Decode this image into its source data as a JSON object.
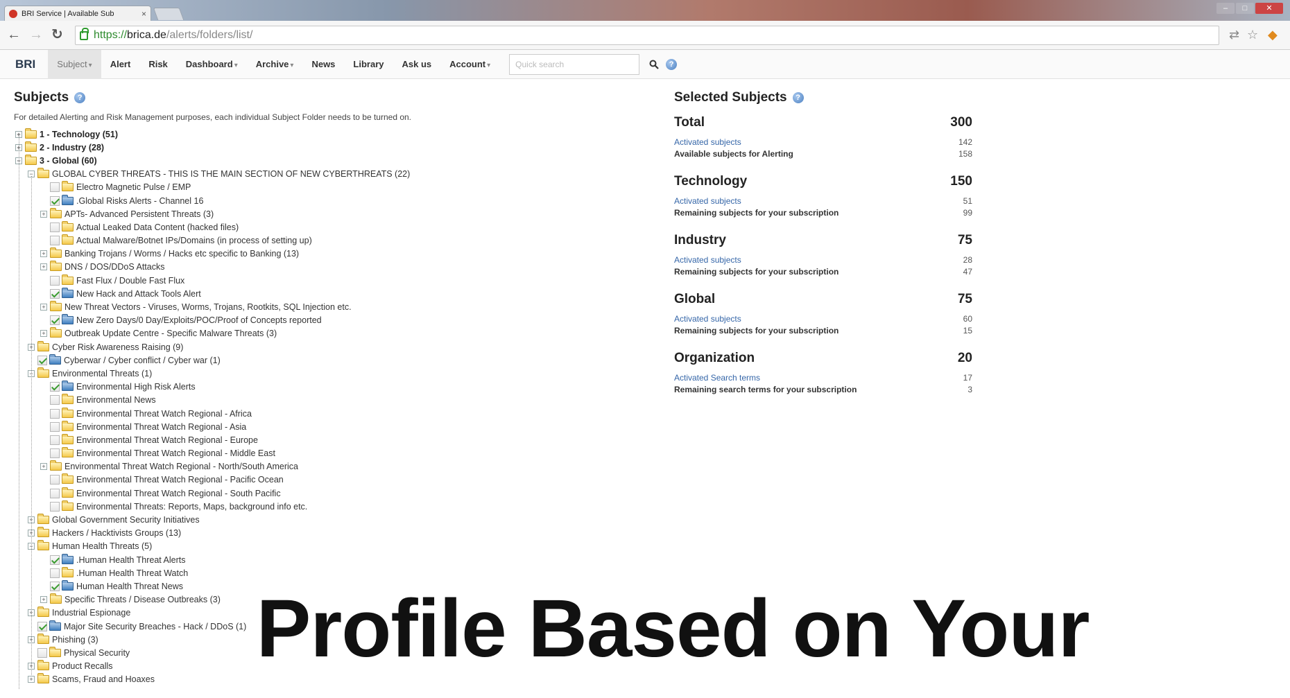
{
  "browser": {
    "tab_title": "BRI Service | Available Sub",
    "tab_close": "×",
    "url_scheme": "https://",
    "url_host": "brica.de",
    "url_path": "/alerts/folders/list/"
  },
  "navbar": {
    "brand": "BRI",
    "items": [
      {
        "label": "Subject",
        "dropdown": true,
        "active": true
      },
      {
        "label": "Alert",
        "dropdown": false
      },
      {
        "label": "Risk",
        "dropdown": false
      },
      {
        "label": "Dashboard",
        "dropdown": true
      },
      {
        "label": "Archive",
        "dropdown": true
      },
      {
        "label": "News",
        "dropdown": false
      },
      {
        "label": "Library",
        "dropdown": false
      },
      {
        "label": "Ask us",
        "dropdown": false
      },
      {
        "label": "Account",
        "dropdown": true
      }
    ],
    "search_placeholder": "Quick search"
  },
  "subjects": {
    "title": "Subjects",
    "description": "For detailed Alerting and Risk Management purposes, each individual Subject Folder needs to be turned on.",
    "tree": [
      {
        "label": "1 - Technology (51)",
        "level": 0,
        "expander": "+",
        "checkbox": false,
        "bold": true,
        "folder": "yellow"
      },
      {
        "label": "2 - Industry (28)",
        "level": 0,
        "expander": "+",
        "checkbox": false,
        "bold": true,
        "folder": "yellow"
      },
      {
        "label": "3 - Global (60)",
        "level": 0,
        "expander": "-",
        "checkbox": false,
        "bold": true,
        "folder": "yellow"
      },
      {
        "label": "GLOBAL CYBER THREATS - THIS IS THE MAIN SECTION OF NEW CYBERTHREATS (22)",
        "level": 1,
        "expander": "-",
        "checkbox": false,
        "folder": "yellow"
      },
      {
        "label": "Electro Magnetic Pulse / EMP",
        "level": 2,
        "expander": "",
        "checkbox": "off",
        "folder": "yellow"
      },
      {
        "label": ".Global Risks Alerts - Channel 16",
        "level": 2,
        "expander": "",
        "checkbox": "on",
        "folder": "blue"
      },
      {
        "label": "APTs- Advanced Persistent Threats (3)",
        "level": 2,
        "expander": "+",
        "checkbox": false,
        "folder": "yellow"
      },
      {
        "label": "Actual Leaked Data Content (hacked files)",
        "level": 2,
        "expander": "",
        "checkbox": "off",
        "folder": "yellow"
      },
      {
        "label": "Actual Malware/Botnet IPs/Domains (in process of setting up)",
        "level": 2,
        "expander": "",
        "checkbox": "off",
        "folder": "yellow"
      },
      {
        "label": "Banking Trojans / Worms / Hacks etc specific to Banking (13)",
        "level": 2,
        "expander": "+",
        "checkbox": false,
        "folder": "yellow"
      },
      {
        "label": "DNS / DOS/DDoS Attacks",
        "level": 2,
        "expander": "+",
        "checkbox": false,
        "folder": "yellow"
      },
      {
        "label": "Fast Flux / Double Fast Flux",
        "level": 2,
        "expander": "",
        "checkbox": "off",
        "folder": "yellow"
      },
      {
        "label": "New Hack and Attack Tools Alert",
        "level": 2,
        "expander": "",
        "checkbox": "on",
        "folder": "blue"
      },
      {
        "label": "New Threat Vectors - Viruses, Worms, Trojans, Rootkits, SQL Injection etc.",
        "level": 2,
        "expander": "+",
        "checkbox": false,
        "folder": "yellow"
      },
      {
        "label": "New Zero Days/0 Day/Exploits/POC/Proof of Concepts reported",
        "level": 2,
        "expander": "",
        "checkbox": "on",
        "folder": "blue"
      },
      {
        "label": "Outbreak Update Centre - Specific Malware Threats (3)",
        "level": 2,
        "expander": "+",
        "checkbox": false,
        "folder": "yellow"
      },
      {
        "label": "Cyber Risk Awareness Raising (9)",
        "level": 1,
        "expander": "+",
        "checkbox": false,
        "folder": "yellow"
      },
      {
        "label": "Cyberwar / Cyber conflict / Cyber war (1)",
        "level": 1,
        "expander": "",
        "checkbox": "on",
        "folder": "blue"
      },
      {
        "label": "Environmental Threats (1)",
        "level": 1,
        "expander": "-",
        "checkbox": false,
        "folder": "yellow"
      },
      {
        "label": "Environmental High Risk Alerts",
        "level": 2,
        "expander": "",
        "checkbox": "on",
        "folder": "blue"
      },
      {
        "label": "Environmental News",
        "level": 2,
        "expander": "",
        "checkbox": "off",
        "folder": "yellow"
      },
      {
        "label": "Environmental Threat Watch Regional - Africa",
        "level": 2,
        "expander": "",
        "checkbox": "off",
        "folder": "yellow"
      },
      {
        "label": "Environmental Threat Watch Regional - Asia",
        "level": 2,
        "expander": "",
        "checkbox": "off",
        "folder": "yellow"
      },
      {
        "label": "Environmental Threat Watch Regional - Europe",
        "level": 2,
        "expander": "",
        "checkbox": "off",
        "folder": "yellow"
      },
      {
        "label": "Environmental Threat Watch Regional - Middle East",
        "level": 2,
        "expander": "",
        "checkbox": "off",
        "folder": "yellow"
      },
      {
        "label": "Environmental Threat Watch Regional - North/South America",
        "level": 2,
        "expander": "+",
        "checkbox": false,
        "folder": "yellow"
      },
      {
        "label": "Environmental Threat Watch Regional - Pacific Ocean",
        "level": 2,
        "expander": "",
        "checkbox": "off",
        "folder": "yellow"
      },
      {
        "label": "Environmental Threat Watch Regional - South Pacific",
        "level": 2,
        "expander": "",
        "checkbox": "off",
        "folder": "yellow"
      },
      {
        "label": "Environmental Threats: Reports, Maps, background info etc.",
        "level": 2,
        "expander": "",
        "checkbox": "off",
        "folder": "yellow"
      },
      {
        "label": "Global Government Security Initiatives",
        "level": 1,
        "expander": "+",
        "checkbox": false,
        "folder": "yellow"
      },
      {
        "label": "Hackers / Hacktivists Groups (13)",
        "level": 1,
        "expander": "+",
        "checkbox": false,
        "folder": "yellow"
      },
      {
        "label": "Human Health Threats (5)",
        "level": 1,
        "expander": "-",
        "checkbox": false,
        "folder": "yellow"
      },
      {
        "label": ".Human Health Threat Alerts",
        "level": 2,
        "expander": "",
        "checkbox": "on",
        "folder": "blue"
      },
      {
        "label": ".Human Health Threat Watch",
        "level": 2,
        "expander": "",
        "checkbox": "off",
        "folder": "yellow"
      },
      {
        "label": "Human Health Threat News",
        "level": 2,
        "expander": "",
        "checkbox": "on",
        "folder": "blue"
      },
      {
        "label": "Specific Threats / Disease Outbreaks (3)",
        "level": 2,
        "expander": "+",
        "checkbox": false,
        "folder": "yellow"
      },
      {
        "label": "Industrial Espionage",
        "level": 1,
        "expander": "+",
        "checkbox": false,
        "folder": "yellow"
      },
      {
        "label": "Major Site Security Breaches - Hack / DDoS (1)",
        "level": 1,
        "expander": "",
        "checkbox": "on",
        "folder": "blue"
      },
      {
        "label": "Phishing (3)",
        "level": 1,
        "expander": "+",
        "checkbox": false,
        "folder": "yellow"
      },
      {
        "label": "Physical Security",
        "level": 1,
        "expander": "",
        "checkbox": "off",
        "folder": "yellow"
      },
      {
        "label": "Product Recalls",
        "level": 1,
        "expander": "+",
        "checkbox": false,
        "folder": "yellow"
      },
      {
        "label": "Scams, Fraud and Hoaxes",
        "level": 1,
        "expander": "+",
        "checkbox": false,
        "folder": "yellow"
      }
    ]
  },
  "selected": {
    "title": "Selected Subjects",
    "sections": [
      {
        "name": "Total",
        "total": "300",
        "rows": [
          {
            "label": "Activated subjects",
            "value": "142",
            "style": "link"
          },
          {
            "label": "Available subjects for Alerting",
            "value": "158",
            "style": "dark"
          }
        ]
      },
      {
        "name": "Technology",
        "total": "150",
        "rows": [
          {
            "label": "Activated subjects",
            "value": "51",
            "style": "link"
          },
          {
            "label": "Remaining subjects for your subscription",
            "value": "99",
            "style": "dark"
          }
        ]
      },
      {
        "name": "Industry",
        "total": "75",
        "rows": [
          {
            "label": "Activated subjects",
            "value": "28",
            "style": "link"
          },
          {
            "label": "Remaining subjects for your subscription",
            "value": "47",
            "style": "dark"
          }
        ]
      },
      {
        "name": "Global",
        "total": "75",
        "rows": [
          {
            "label": "Activated subjects",
            "value": "60",
            "style": "link"
          },
          {
            "label": "Remaining subjects for your subscription",
            "value": "15",
            "style": "dark"
          }
        ]
      },
      {
        "name": "Organization",
        "total": "20",
        "rows": [
          {
            "label": "Activated Search terms",
            "value": "17",
            "style": "link"
          },
          {
            "label": "Remaining search terms for your subscription",
            "value": "3",
            "style": "dark"
          }
        ]
      }
    ]
  },
  "overlay_caption": "Profile Based on Your",
  "icons": {
    "back": "back-arrow-icon",
    "forward": "forward-arrow-icon",
    "reload": "reload-icon",
    "lock": "lock-icon",
    "search": "search-icon",
    "help": "help-icon",
    "star": "bookmark-star-icon"
  },
  "colors": {
    "link": "#3566a8",
    "check": "#3a9c2f",
    "folder": "#f5c94a",
    "folder_active": "#3f7fc0"
  }
}
